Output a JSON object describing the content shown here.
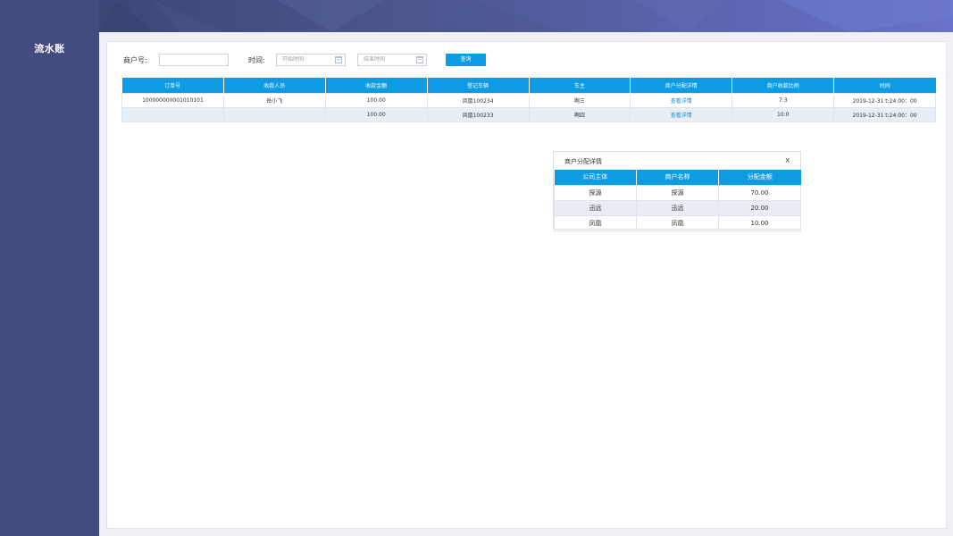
{
  "sidebar": {
    "title": "流水账"
  },
  "filters": {
    "merchant_label": "商户号:",
    "merchant_value": "",
    "time_label": "时间:",
    "start_placeholder": "开始时间",
    "end_placeholder": "结束时间",
    "query_label": "查询"
  },
  "table": {
    "headers": [
      "订单号",
      "收款人员",
      "收款金额",
      "登记车辆",
      "车主",
      "商户分配详情",
      "商户收款比例",
      "时间"
    ],
    "rows": [
      {
        "order_no": "100000000001010101",
        "collector": "岳小飞",
        "amount": "100.00",
        "vehicle": "凤凰100234",
        "owner": "啊三",
        "detail": "查看详情",
        "ratio": "7:3",
        "time": "2019-12-31 t:24:00：00"
      },
      {
        "order_no": "",
        "collector": "",
        "amount": "100.00",
        "vehicle": "凤凰100233",
        "owner": "啊四",
        "detail": "查看详情",
        "ratio": "10:0",
        "time": "2019-12-31 t:24:00：00"
      }
    ]
  },
  "popup": {
    "title": "商户分配详情",
    "close": "X",
    "headers": [
      "公司主体",
      "商户名称",
      "分配金额"
    ],
    "rows": [
      {
        "company": "探源",
        "merchant": "探源",
        "amount": "70.00"
      },
      {
        "company": "迅远",
        "merchant": "迅远",
        "amount": "20.00"
      },
      {
        "company": "凤凰",
        "merchant": "凤凰",
        "amount": "10.00"
      }
    ]
  },
  "colors": {
    "sidebar": "#444b80",
    "accent": "#0d9be3",
    "link": "#0d8fd6"
  }
}
